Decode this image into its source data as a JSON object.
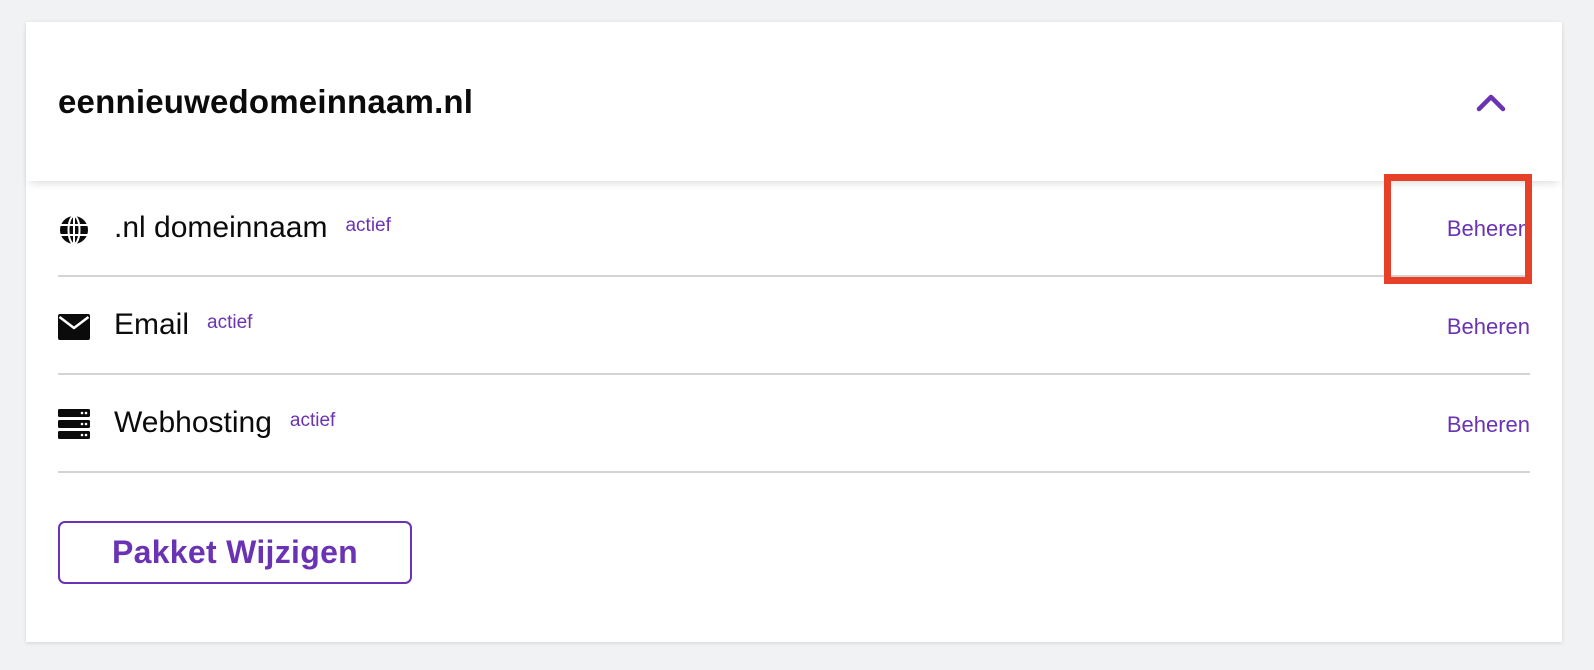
{
  "header": {
    "domain_name": "eennieuwedomeinnaam.nl",
    "toggle_icon": "chevron-up-icon"
  },
  "products": [
    {
      "icon": "globe-icon",
      "name": ".nl domeinnaam",
      "status": "actief",
      "action": "Beheren"
    },
    {
      "icon": "envelope-icon",
      "name": "Email",
      "status": "actief",
      "action": "Beheren"
    },
    {
      "icon": "server-icon",
      "name": "Webhosting",
      "status": "actief",
      "action": "Beheren"
    }
  ],
  "footer": {
    "change_package_label": "Pakket Wijzigen"
  },
  "colors": {
    "accent": "#6a33b3",
    "highlight": "#e64028",
    "text": "#0b0b0b",
    "divider": "#d3d3d6",
    "background": "#f1f2f4"
  }
}
